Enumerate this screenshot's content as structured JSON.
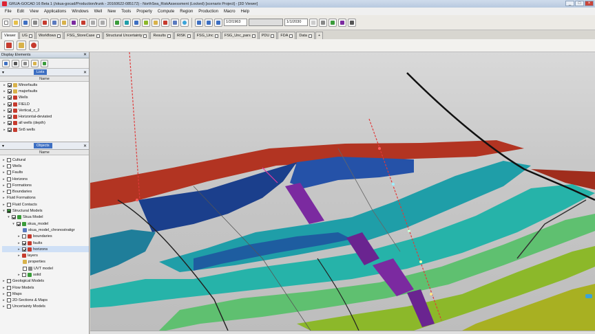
{
  "titlebar": {
    "title": "GRUA-GOCAD 16 Beta 1 (/skua-gocad/Production/trunk - 20160622-085172) - NorthSea_RiskAssessment (Locked) [scenario Project] - [3D Viewer]",
    "buttons": [
      "_",
      "□",
      "×"
    ]
  },
  "menu": [
    "File",
    "Edit",
    "View",
    "Applications",
    "Windows",
    "Well",
    "New",
    "Tools",
    "Property",
    "Compute",
    "Region",
    "Production",
    "Macro",
    "Help"
  ],
  "toolbar": {
    "date_start": "1/2/1963",
    "date_end": "1/1/2030"
  },
  "tabs": [
    "Viewer",
    "UG",
    "Workflows",
    "FSG_StoreCase",
    "Structural Uncertainty",
    "Results",
    "RISK",
    "FSG_Unc",
    "FSG_Unc_pars",
    "PDU",
    "FDA",
    "Data",
    "+"
  ],
  "panels": {
    "display_elements": "Display Elements",
    "lists_label": "Lists",
    "objects_label": "Objects",
    "name_col": "Name"
  },
  "lists": [
    {
      "label": "Minorfaults",
      "checked": true,
      "color": "#d8b24a"
    },
    {
      "label": "majorfaults",
      "checked": true,
      "color": "#d8b24a"
    },
    {
      "label": "Wells",
      "checked": true,
      "color": "#c63b2e"
    },
    {
      "label": "FIELD",
      "checked": true,
      "color": "#c63b2e"
    },
    {
      "label": "Vertical_c_2",
      "checked": true,
      "color": "#c63b2e"
    },
    {
      "label": "Horizontal-deviated",
      "checked": true,
      "color": "#c63b2e"
    },
    {
      "label": "all wells (depth)",
      "checked": true,
      "color": "#c63b2e"
    },
    {
      "label": "Sn5 wells",
      "checked": true,
      "color": "#c63b2e"
    }
  ],
  "objects": [
    {
      "label": "Cultural",
      "indent": 0,
      "checked": false,
      "color": ""
    },
    {
      "label": "Wells",
      "indent": 0,
      "checked": false,
      "color": ""
    },
    {
      "label": "Faults",
      "indent": 0,
      "checked": false,
      "color": ""
    },
    {
      "label": "Horizons",
      "indent": 0,
      "checked": false,
      "color": ""
    },
    {
      "label": "Formations",
      "indent": 0,
      "checked": false,
      "color": ""
    },
    {
      "label": "Boundaries",
      "indent": 0,
      "checked": false,
      "color": ""
    },
    {
      "label": "Fluid Formations",
      "indent": 0,
      "checked": false,
      "color": ""
    },
    {
      "label": "Fluid Contacts",
      "indent": 0,
      "checked": false,
      "color": ""
    },
    {
      "label": "Structural Models",
      "indent": 0,
      "checked": true,
      "color": ""
    },
    {
      "label": "Skua Model",
      "indent": 1,
      "checked": true,
      "color": "#3a9c3a"
    },
    {
      "label": "skua_model",
      "indent": 2,
      "checked": true,
      "color": "#3a9c3a"
    },
    {
      "label": "skua_model_chronostratigr",
      "indent": 3,
      "checked": false,
      "color": "#5a7abf"
    },
    {
      "label": "boundaries",
      "indent": 3,
      "checked": false,
      "color": "#c63b2e"
    },
    {
      "label": "faults",
      "indent": 3,
      "checked": true,
      "color": "#c63b2e"
    },
    {
      "label": "horizons",
      "indent": 3,
      "checked": true,
      "color": "#c63b2e"
    },
    {
      "label": "layers",
      "indent": 3,
      "checked": false,
      "color": "#c63b2e"
    },
    {
      "label": "properties",
      "indent": 3,
      "checked": false,
      "color": "#d8b24a"
    },
    {
      "label": "UVT model",
      "indent": 3,
      "checked": false,
      "color": "#888"
    },
    {
      "label": "solid",
      "indent": 3,
      "checked": false,
      "color": "#3a9c3a"
    },
    {
      "label": "Geological Models",
      "indent": 0,
      "checked": false,
      "color": ""
    },
    {
      "label": "Flow Models",
      "indent": 0,
      "checked": false,
      "color": ""
    },
    {
      "label": "Maps",
      "indent": 0,
      "checked": false,
      "color": ""
    },
    {
      "label": "2D-Sections & Maps",
      "indent": 0,
      "checked": false,
      "color": ""
    },
    {
      "label": "Uncertainty Models",
      "indent": 0,
      "checked": false,
      "color": ""
    }
  ],
  "colors": {
    "horizon_red": "#b23422",
    "horizon_blue": "#1b3f8c",
    "horizon_teal": "#1f9ea8",
    "horizon_green": "#8cb82a",
    "fault_purple": "#7b2aa0",
    "well": "#e03a3a"
  }
}
